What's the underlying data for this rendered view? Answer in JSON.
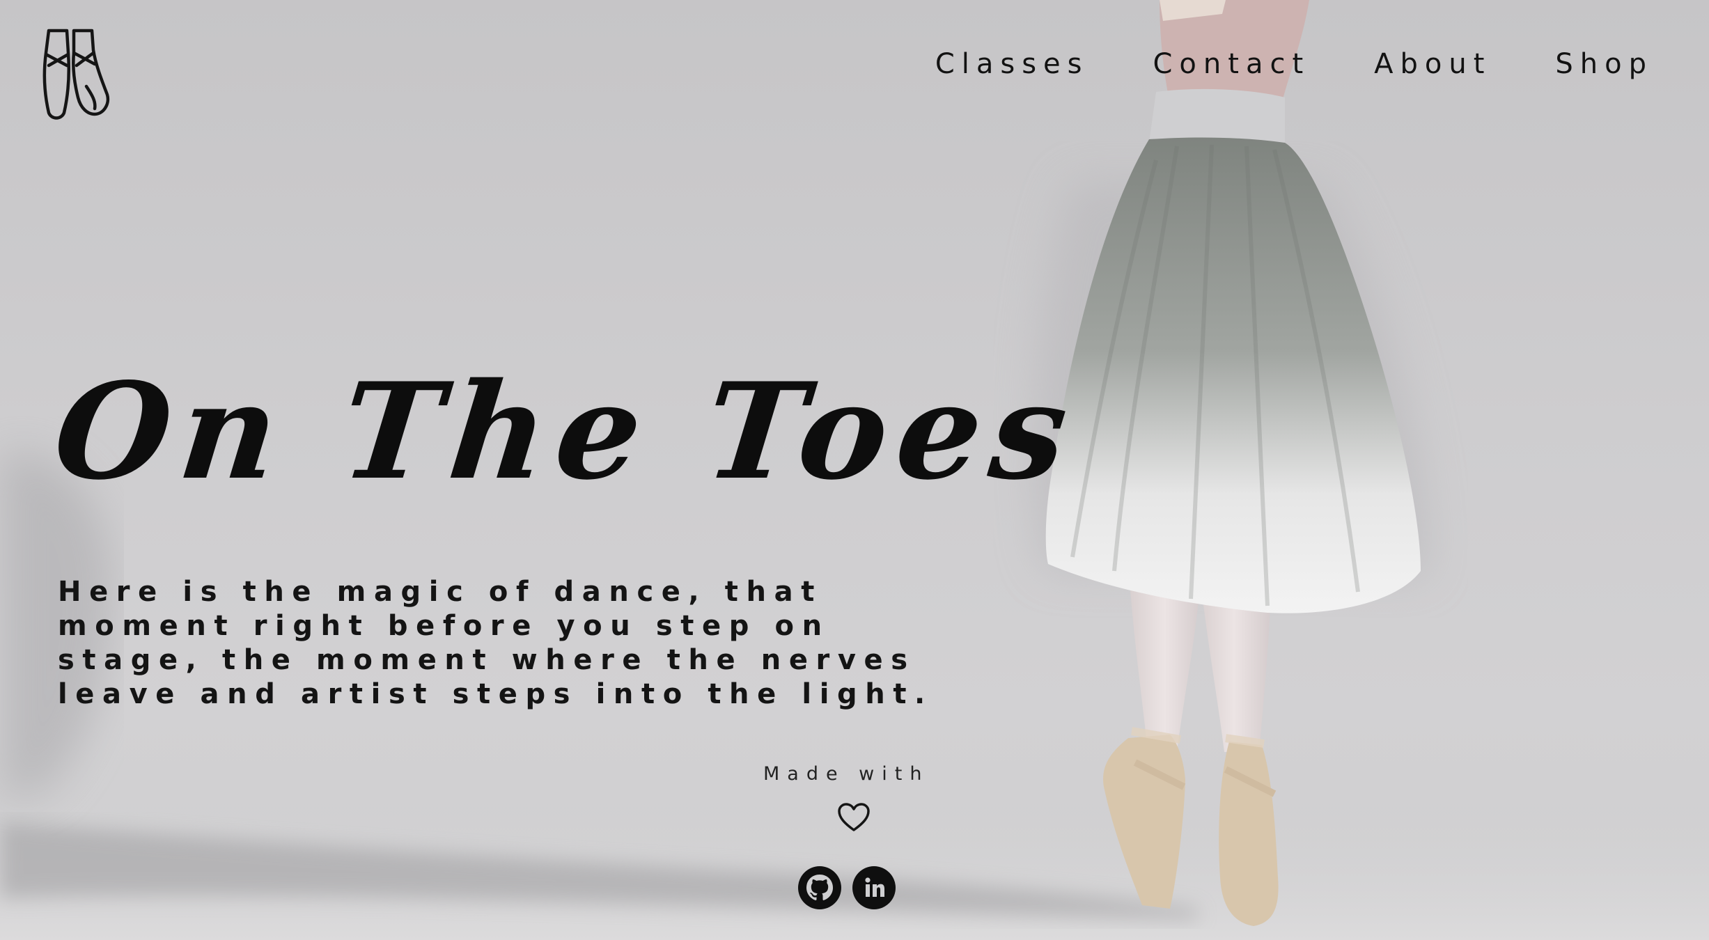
{
  "brand": {
    "logo_icon": "pointe-shoes-icon"
  },
  "nav": {
    "items": [
      {
        "label": "Classes"
      },
      {
        "label": "Contact"
      },
      {
        "label": "About"
      },
      {
        "label": "Shop"
      }
    ]
  },
  "hero": {
    "title": "On The Toes",
    "text": "Here is the magic of dance, that moment right before you step on stage, the moment where the nerves leave and artist steps into the light."
  },
  "footer": {
    "made_with": "Made with",
    "heart_icon": "heart-icon",
    "social": [
      {
        "icon": "github-icon"
      },
      {
        "icon": "linkedin-icon"
      }
    ]
  },
  "colors": {
    "background": "#cdccce",
    "text": "#111111",
    "skirt": "#8f938f",
    "shoe": "#d8c6ac"
  }
}
